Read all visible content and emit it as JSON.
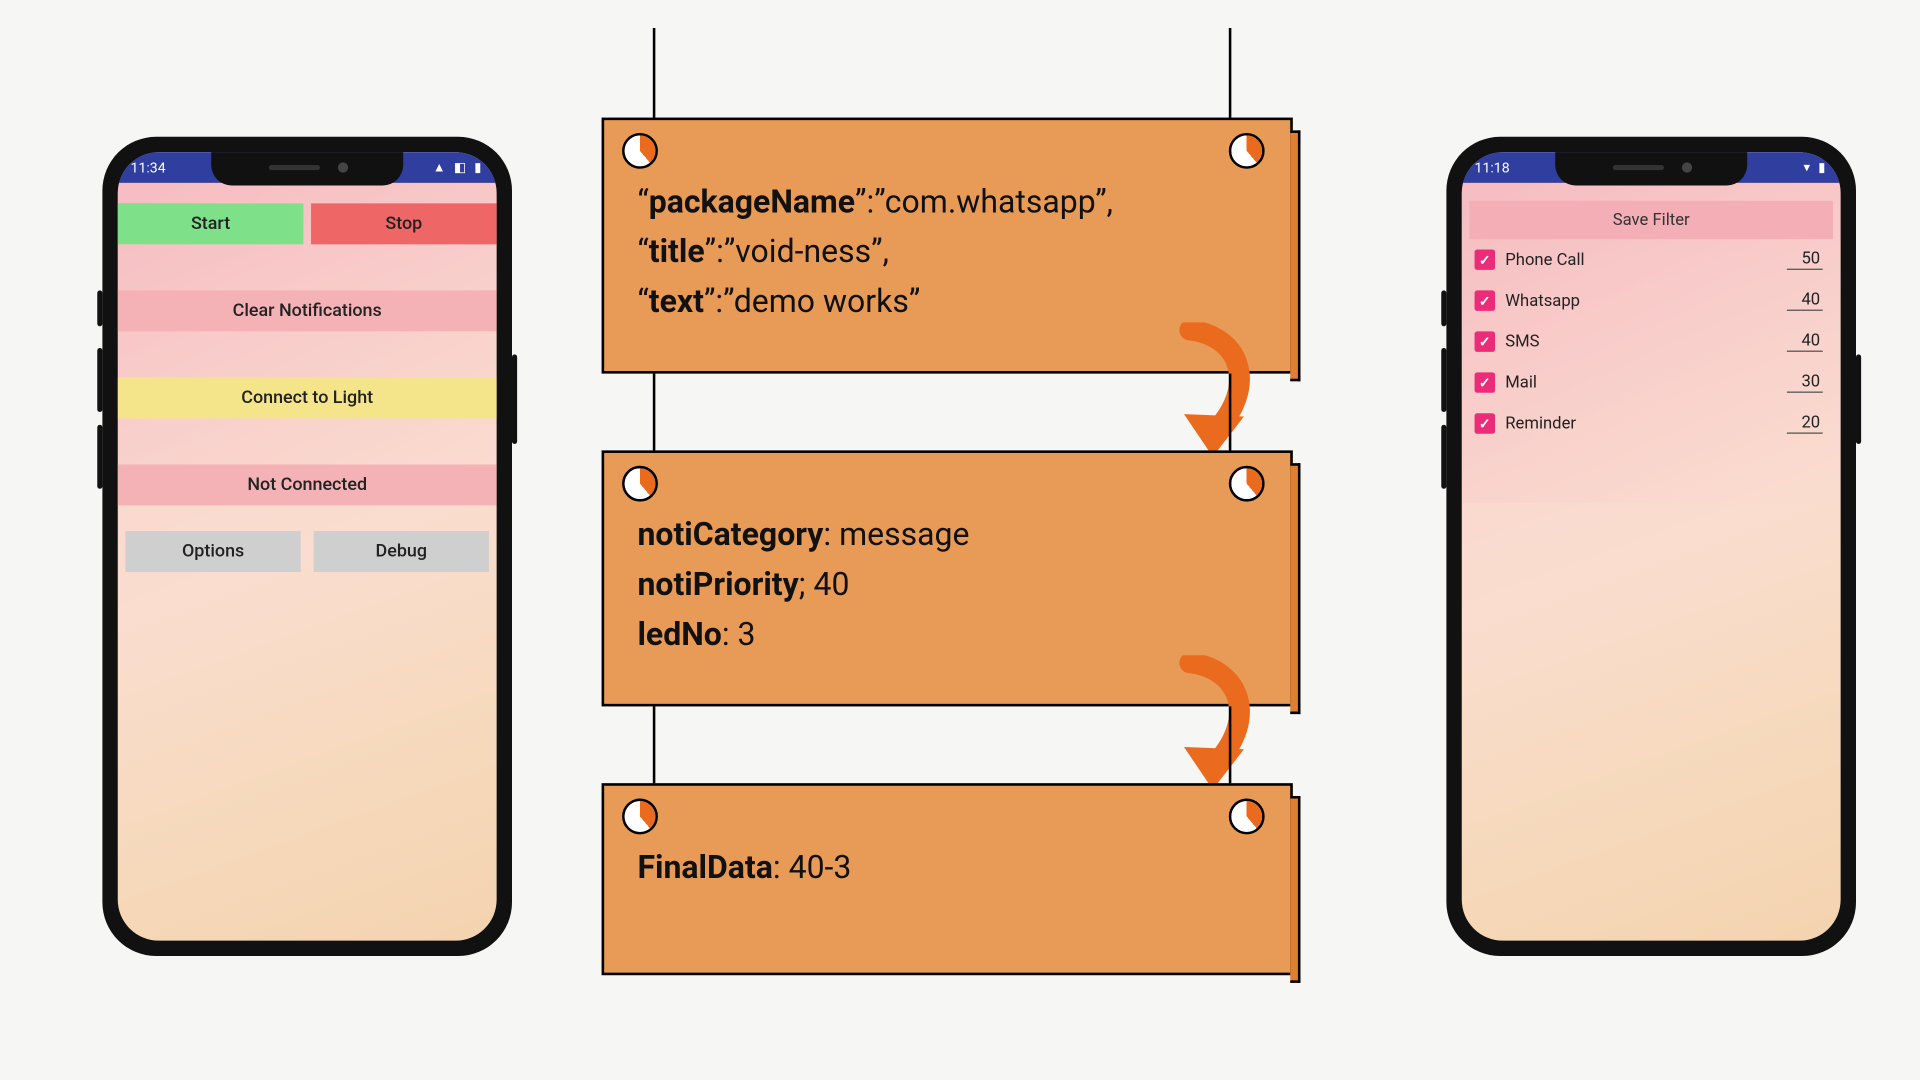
{
  "phoneLeft": {
    "time": "11:34",
    "start": "Start",
    "stop": "Stop",
    "clear": "Clear Notifications",
    "connect": "Connect to Light",
    "status": "Not Connected",
    "options": "Options",
    "debug": "Debug"
  },
  "phoneRight": {
    "time": "11:18",
    "saveFilter": "Save Filter",
    "filters": [
      {
        "label": "Phone Call",
        "value": "50"
      },
      {
        "label": "Whatsapp",
        "value": "40"
      },
      {
        "label": "SMS",
        "value": "40"
      },
      {
        "label": "Mail",
        "value": "30"
      },
      {
        "label": "Reminder",
        "value": "20"
      }
    ]
  },
  "flow": {
    "board1": {
      "k1": "packageName",
      "v1": "com.whatsapp",
      "k2": "title",
      "v2": "void-ness",
      "k3": "text",
      "v3": "demo works"
    },
    "board2": {
      "k1": "notiCategory",
      "v1": "message",
      "k2": "notiPriority",
      "v2": "40",
      "k3": "ledNo",
      "v3": "3"
    },
    "board3": {
      "k1": "FinalData",
      "v1": "40-3"
    }
  }
}
